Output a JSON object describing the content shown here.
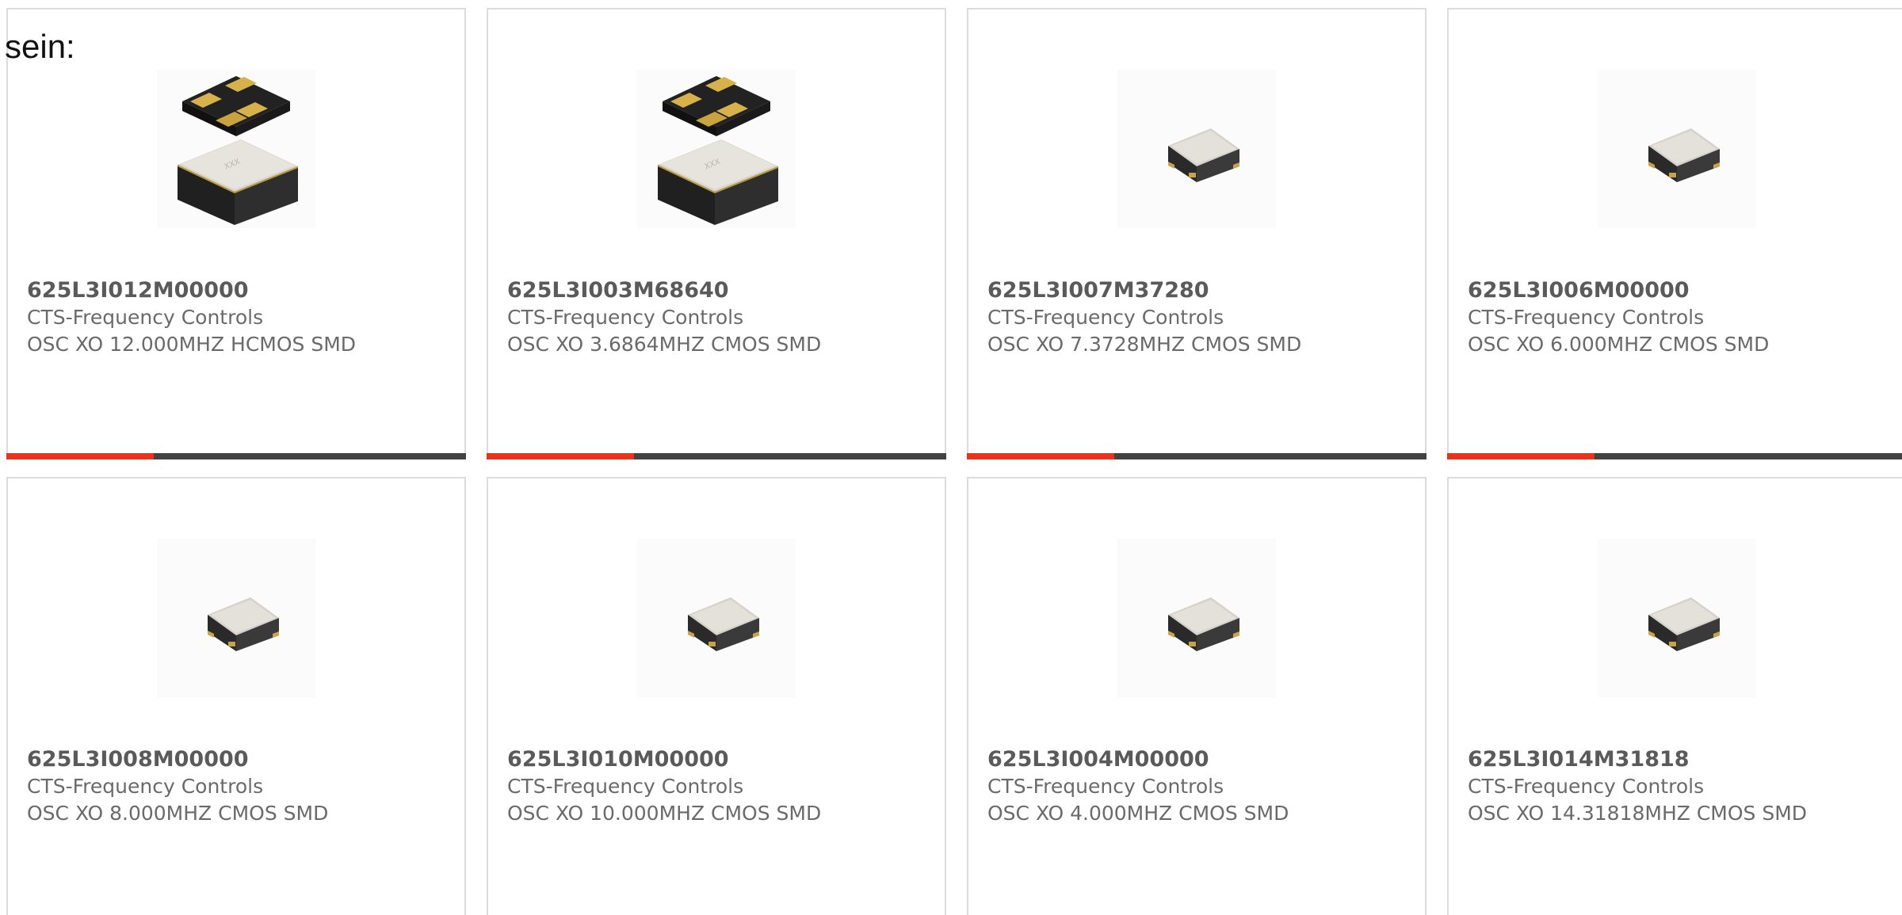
{
  "intro_text": "sein:",
  "colors": {
    "card_border": "#dcdcdc",
    "bar_track": "#424242",
    "bar_accent": "#e8341c"
  },
  "products": [
    {
      "part_number": "625L3I012M00000",
      "manufacturer": "CTS-Frequency Controls",
      "description": "OSC XO 12.000MHZ HCMOS SMD",
      "image_icon": "oscillator-package-icon",
      "progress": 0.32
    },
    {
      "part_number": "625L3I003M68640",
      "manufacturer": "CTS-Frequency Controls",
      "description": "OSC XO 3.6864MHZ CMOS SMD",
      "image_icon": "oscillator-package-icon",
      "progress": 0.32
    },
    {
      "part_number": "625L3I007M37280",
      "manufacturer": "CTS-Frequency Controls",
      "description": "OSC XO 7.3728MHZ CMOS SMD",
      "image_icon": "smd-chip-icon",
      "progress": 0.32
    },
    {
      "part_number": "625L3I006M00000",
      "manufacturer": "CTS-Frequency Controls",
      "description": "OSC XO 6.000MHZ CMOS SMD",
      "image_icon": "smd-chip-icon",
      "progress": 0.32
    },
    {
      "part_number": "625L3I008M00000",
      "manufacturer": "CTS-Frequency Controls",
      "description": "OSC XO 8.000MHZ CMOS SMD",
      "image_icon": "smd-chip-icon"
    },
    {
      "part_number": "625L3I010M00000",
      "manufacturer": "CTS-Frequency Controls",
      "description": "OSC XO 10.000MHZ CMOS SMD",
      "image_icon": "smd-chip-icon"
    },
    {
      "part_number": "625L3I004M00000",
      "manufacturer": "CTS-Frequency Controls",
      "description": "OSC XO 4.000MHZ CMOS SMD",
      "image_icon": "smd-chip-icon"
    },
    {
      "part_number": "625L3I014M31818",
      "manufacturer": "CTS-Frequency Controls",
      "description": "OSC XO 14.31818MHZ CMOS SMD",
      "image_icon": "smd-chip-icon"
    }
  ]
}
